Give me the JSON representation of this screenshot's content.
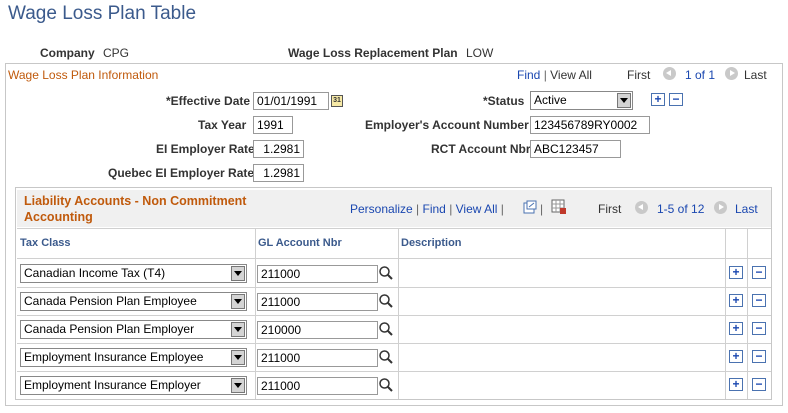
{
  "page": {
    "title": "Wage Loss Plan Table"
  },
  "header": {
    "company_label": "Company",
    "company_value": "CPG",
    "plan_label": "Wage Loss Replacement Plan",
    "plan_value": "LOW"
  },
  "section": {
    "title": "Wage Loss Plan Information",
    "find": "Find",
    "view_all": "View All",
    "first": "First",
    "range": "1 of 1",
    "last": "Last"
  },
  "form": {
    "effective_date_label": "*Effective Date",
    "effective_date_value": "01/01/1991",
    "status_label": "*Status",
    "status_value": "Active",
    "tax_year_label": "Tax Year",
    "tax_year_value": "1991",
    "employer_account_label": "Employer's Account Number",
    "employer_account_value": "123456789RY0002",
    "ei_rate_label": "EI Employer Rate",
    "ei_rate_value": "1.2981",
    "rct_label": "RCT Account Nbr",
    "rct_value": "ABC123457",
    "quebec_rate_label": "Quebec EI Employer Rate",
    "quebec_rate_value": "1.2981",
    "calendar_icon_text": "31"
  },
  "grid": {
    "title_line1": "Liability Accounts - Non Commitment",
    "title_line2": "Accounting",
    "personalize": "Personalize",
    "find": "Find",
    "view_all": "View All",
    "first": "First",
    "range": "1-5 of 12",
    "last": "Last",
    "columns": [
      "Tax Class",
      "GL Account Nbr",
      "Description"
    ],
    "rows": [
      {
        "tax_class": "Canadian Income Tax (T4)",
        "gl_account": "211000",
        "description": ""
      },
      {
        "tax_class": "Canada Pension Plan Employee",
        "gl_account": "211000",
        "description": ""
      },
      {
        "tax_class": "Canada Pension Plan Employer",
        "gl_account": "210000",
        "description": ""
      },
      {
        "tax_class": "Employment Insurance Employee",
        "gl_account": "211000",
        "description": ""
      },
      {
        "tax_class": "Employment Insurance Employer",
        "gl_account": "211000",
        "description": ""
      }
    ]
  },
  "buttons": {
    "add": "+",
    "delete": "−"
  },
  "colors": {
    "title_blue": "#3b5a8c",
    "section_orange": "#c05a0c",
    "link_blue": "#1a47b0"
  }
}
